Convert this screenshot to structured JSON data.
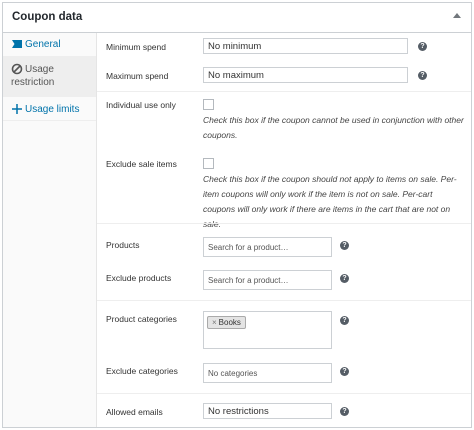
{
  "header": {
    "title": "Coupon data"
  },
  "sidebar": {
    "items": [
      {
        "label": "General",
        "icon": "ticket-icon"
      },
      {
        "label": "Usage restriction",
        "icon": "block-icon"
      },
      {
        "label": "Usage limits",
        "icon": "plus-icon"
      }
    ],
    "active": "Usage restriction"
  },
  "fields": {
    "minimum_spend": {
      "label": "Minimum spend",
      "placeholder": "No minimum"
    },
    "maximum_spend": {
      "label": "Maximum spend",
      "placeholder": "No maximum"
    },
    "individual_use": {
      "label": "Individual use only",
      "description": "Check this box if the coupon cannot be used in conjunction with other coupons.",
      "checked": false
    },
    "exclude_sale": {
      "label": "Exclude sale items",
      "description": "Check this box if the coupon should not apply to items on sale. Per-item coupons will only work if the item is not on sale. Per-cart coupons will only work if there are items in the cart that are not on sale.",
      "checked": false
    },
    "products": {
      "label": "Products",
      "placeholder": "Search for a product…"
    },
    "exclude_products": {
      "label": "Exclude products",
      "placeholder": "Search for a product…"
    },
    "product_categories": {
      "label": "Product categories",
      "tags": [
        "Books"
      ],
      "remove_symbol": "×"
    },
    "exclude_categories": {
      "label": "Exclude categories",
      "placeholder": "No categories"
    },
    "allowed_emails": {
      "label": "Allowed emails",
      "placeholder": "No restrictions"
    }
  },
  "help_symbol": "?",
  "colors": {
    "accent": "#0073aa",
    "border": "#ccd0d4",
    "help": "#555d66"
  }
}
